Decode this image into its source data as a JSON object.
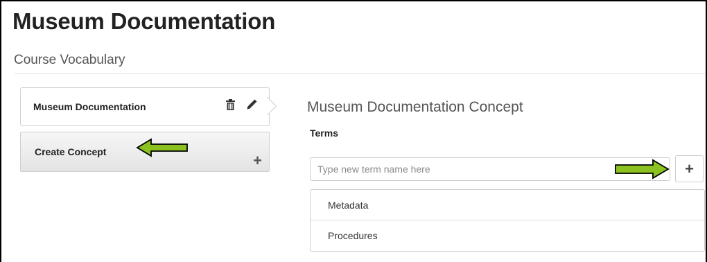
{
  "header": {
    "title": "Museum Documentation",
    "subtitle": "Course Vocabulary"
  },
  "sidebar": {
    "concept": {
      "name": "Museum Documentation",
      "icons": [
        "trash-icon",
        "pencil-icon"
      ]
    },
    "create": {
      "label": "Create Concept",
      "icon": "plus-icon"
    }
  },
  "main": {
    "heading": "Museum Documentation Concept",
    "terms_label": "Terms",
    "new_term": {
      "value": "",
      "placeholder": "Type new term name here"
    },
    "add_button_icon": "plus-icon",
    "terms": [
      {
        "label": "Metadata"
      },
      {
        "label": "Procedures"
      }
    ]
  },
  "annotations": {
    "arrow_color": "#8cc21f",
    "arrow_outline": "#000000"
  }
}
